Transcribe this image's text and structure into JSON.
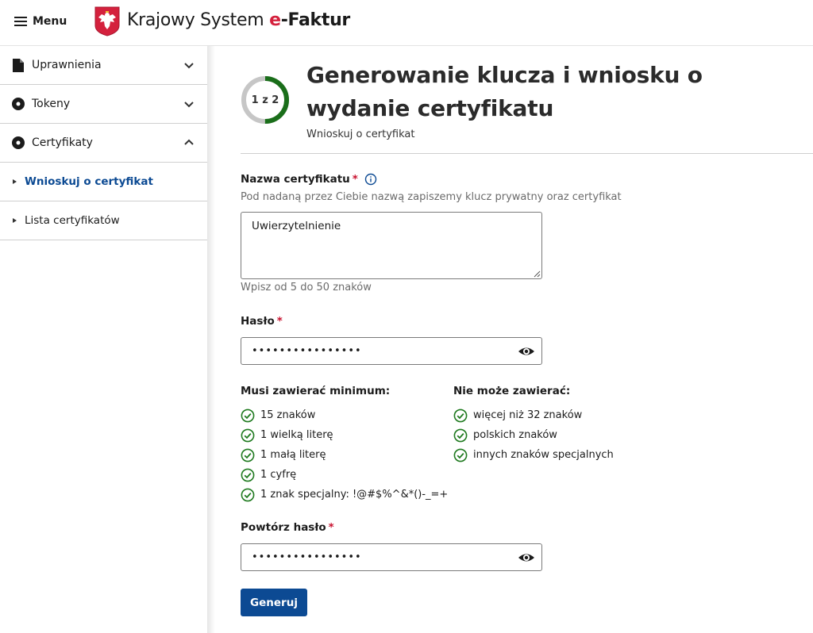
{
  "header": {
    "menu_label": "Menu",
    "app_title_plain": "Krajowy System ",
    "app_title_e": "e",
    "app_title_rest": "-Faktur",
    "logo_icon": "polish-eagle-emblem-icon"
  },
  "sidebar": {
    "items": [
      {
        "label": "Uprawnienia",
        "icon": "document-icon",
        "expanded": false
      },
      {
        "label": "Tokeny",
        "icon": "disc-icon",
        "expanded": false
      },
      {
        "label": "Certyfikaty",
        "icon": "disc-icon",
        "expanded": true
      }
    ],
    "subitems": [
      {
        "label": "Wnioskuj o certyfikat",
        "active": true
      },
      {
        "label": "Lista certyfikatów",
        "active": false
      }
    ]
  },
  "main": {
    "progress": {
      "text": "1 z 2",
      "fraction": 0.5
    },
    "title": "Generowanie klucza i wniosku o wydanie certyfikatu",
    "subtitle": "Wnioskuj o certyfikat",
    "cert_name": {
      "label": "Nazwa certyfikatu",
      "required_mark": "*",
      "description": "Pod nadaną przez Ciebie nazwą zapiszemy klucz prywatny oraz certyfikat",
      "value": "Uwierzytelnienie",
      "hint": "Wpisz od 5 do 50 znaków"
    },
    "password": {
      "label": "Hasło",
      "required_mark": "*",
      "value": "••••••••••••••••"
    },
    "requirements": {
      "must_title": "Musi zawierać minimum:",
      "must": [
        "15 znaków",
        "1 wielką literę",
        "1 małą literę",
        "1 cyfrę",
        "1 znak specjalny: !@#$%^&*()-_=+"
      ],
      "must_not_title": "Nie może zawierać:",
      "must_not": [
        "więcej niż 32 znaków",
        "polskich znaków",
        "innych znaków specjalnych"
      ]
    },
    "repeat_password": {
      "label": "Powtórz hasło",
      "required_mark": "*",
      "value": "••••••••••••••••"
    },
    "submit_label": "Generuj"
  },
  "colors": {
    "primary": "#0c4a93",
    "success": "#1f7a1f",
    "required": "#c8102e",
    "progress_track": "#c6c6c6",
    "progress_fill": "#1a6e1a"
  }
}
